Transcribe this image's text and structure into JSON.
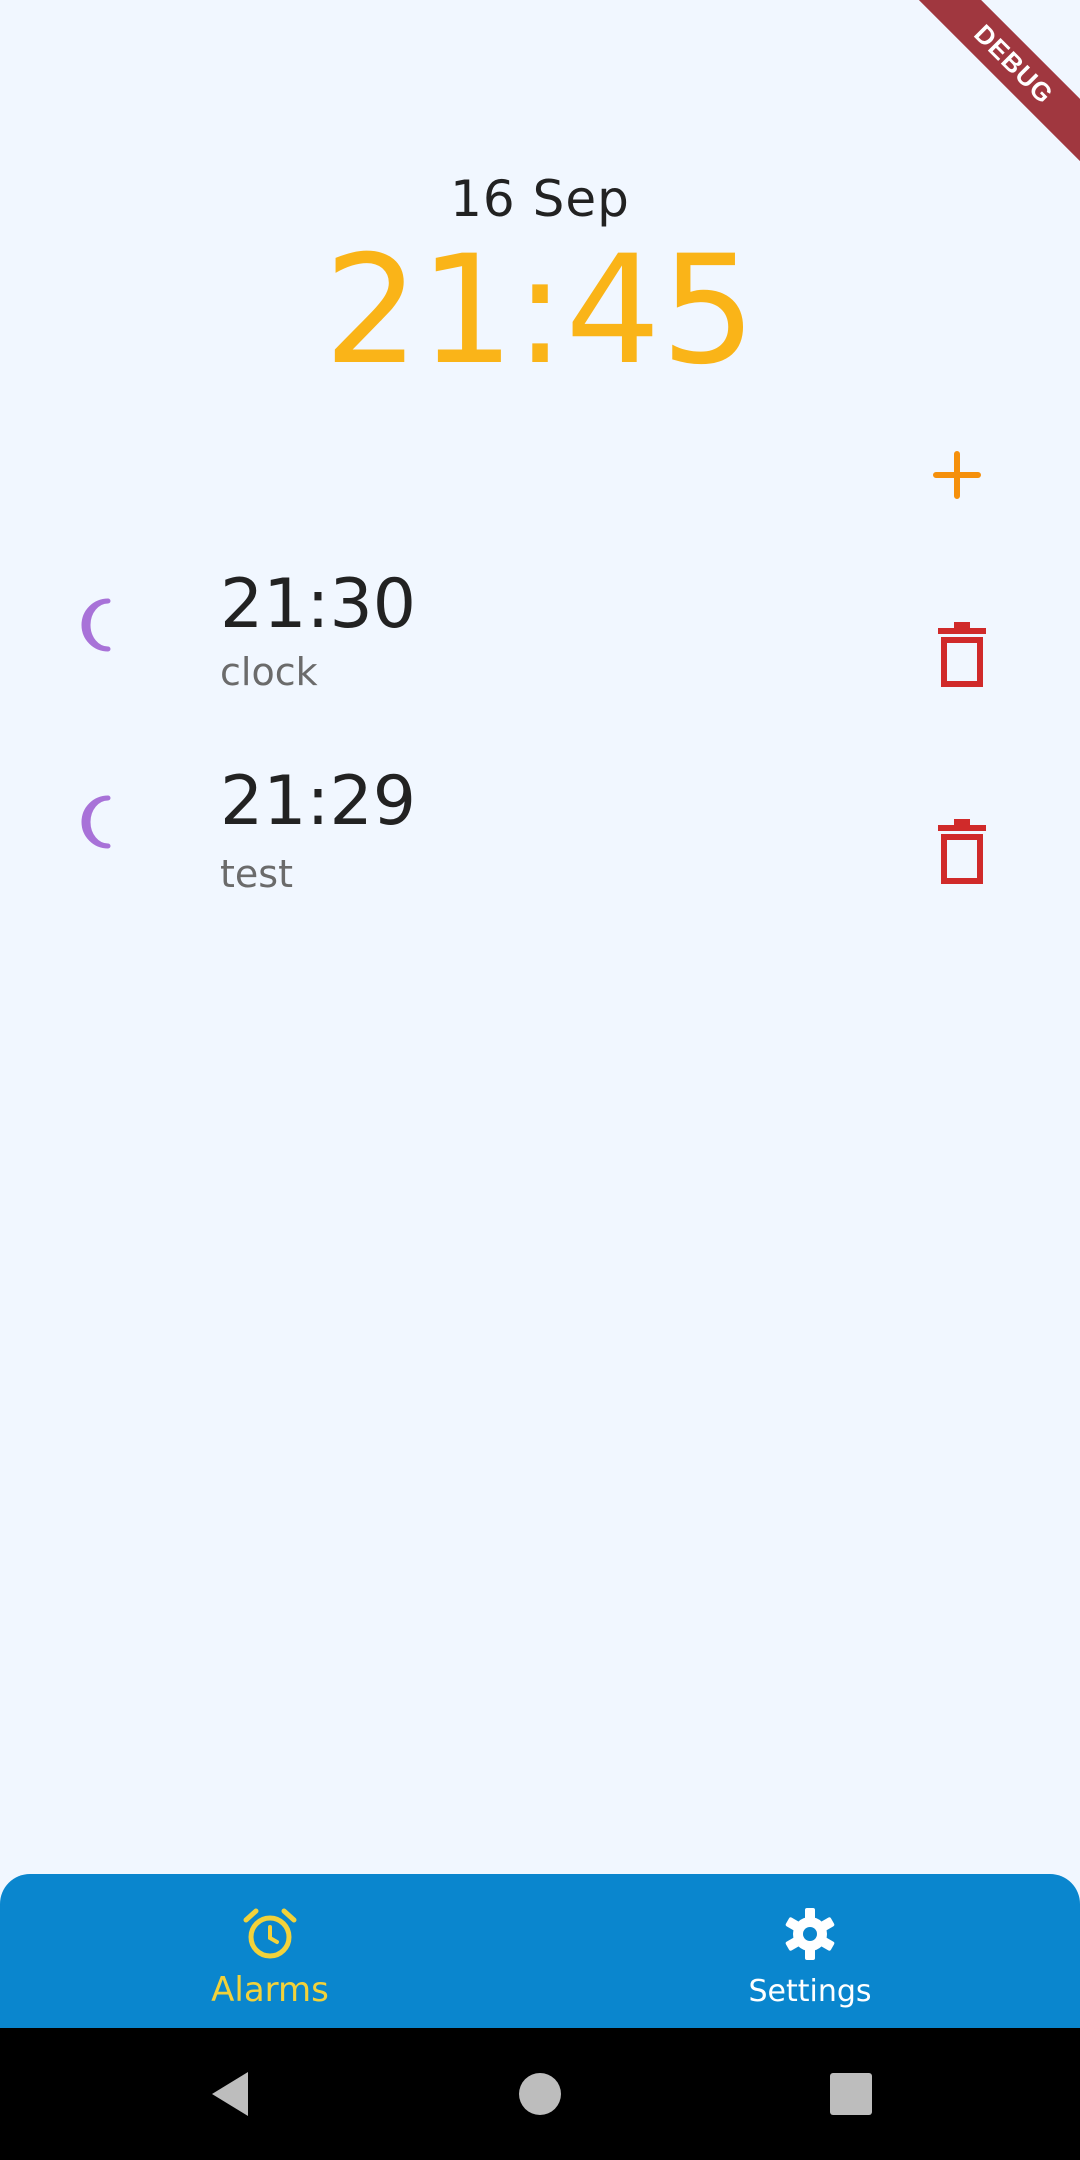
{
  "debug_banner": "DEBUG",
  "header": {
    "date": "16 Sep",
    "time": "21:45"
  },
  "alarms": [
    {
      "time": "21:30",
      "label": "clock"
    },
    {
      "time": "21:29",
      "label": "test"
    }
  ],
  "bottom_nav": {
    "items": [
      {
        "label": "Alarms",
        "icon": "alarm-clock-icon",
        "active": true
      },
      {
        "label": "Settings",
        "icon": "gear-icon",
        "active": false
      }
    ]
  },
  "colors": {
    "background": "#F1F7FF",
    "clock": "#FAB418",
    "add": "#F5900C",
    "moon": "#A872D8",
    "trash": "#D02A2A",
    "nav_bg": "#0A86CE",
    "nav_active": "#F2D23A",
    "nav_inactive": "#FFFFFF"
  }
}
